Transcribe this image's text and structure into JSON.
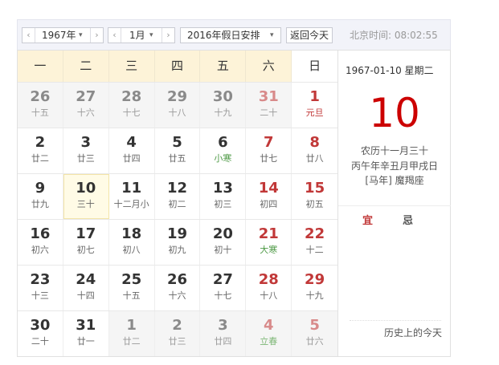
{
  "toolbar": {
    "year": "1967年",
    "month": "1月",
    "holiday": "2016年假日安排",
    "today_label": "返回今天",
    "time_label": "北京时间: 08:02:55",
    "prev_glyph": "‹",
    "next_glyph": "›",
    "caret_glyph": "▾"
  },
  "weekdays": [
    "一",
    "二",
    "三",
    "四",
    "五",
    "六",
    "日"
  ],
  "calendar": {
    "weeks": [
      [
        {
          "num": "26",
          "lunar": "十五",
          "other": true
        },
        {
          "num": "27",
          "lunar": "十六",
          "other": true
        },
        {
          "num": "28",
          "lunar": "十七",
          "other": true
        },
        {
          "num": "29",
          "lunar": "十八",
          "other": true
        },
        {
          "num": "30",
          "lunar": "十九",
          "other": true
        },
        {
          "num": "31",
          "lunar": "二十",
          "other": true,
          "weekend": true
        },
        {
          "num": "1",
          "lunar": "元旦",
          "weekend": true,
          "festival": true
        }
      ],
      [
        {
          "num": "2",
          "lunar": "廿二"
        },
        {
          "num": "3",
          "lunar": "廿三"
        },
        {
          "num": "4",
          "lunar": "廿四"
        },
        {
          "num": "5",
          "lunar": "廿五"
        },
        {
          "num": "6",
          "lunar": "小寒",
          "term": true
        },
        {
          "num": "7",
          "lunar": "廿七",
          "weekend": true
        },
        {
          "num": "8",
          "lunar": "廿八",
          "weekend": true
        }
      ],
      [
        {
          "num": "9",
          "lunar": "廿九"
        },
        {
          "num": "10",
          "lunar": "三十",
          "selected": true
        },
        {
          "num": "11",
          "lunar": "十二月小"
        },
        {
          "num": "12",
          "lunar": "初二"
        },
        {
          "num": "13",
          "lunar": "初三"
        },
        {
          "num": "14",
          "lunar": "初四",
          "weekend": true
        },
        {
          "num": "15",
          "lunar": "初五",
          "weekend": true
        }
      ],
      [
        {
          "num": "16",
          "lunar": "初六"
        },
        {
          "num": "17",
          "lunar": "初七"
        },
        {
          "num": "18",
          "lunar": "初八"
        },
        {
          "num": "19",
          "lunar": "初九"
        },
        {
          "num": "20",
          "lunar": "初十"
        },
        {
          "num": "21",
          "lunar": "大寒",
          "weekend": true,
          "term": true
        },
        {
          "num": "22",
          "lunar": "十二",
          "weekend": true
        }
      ],
      [
        {
          "num": "23",
          "lunar": "十三"
        },
        {
          "num": "24",
          "lunar": "十四"
        },
        {
          "num": "25",
          "lunar": "十五"
        },
        {
          "num": "26",
          "lunar": "十六"
        },
        {
          "num": "27",
          "lunar": "十七"
        },
        {
          "num": "28",
          "lunar": "十八",
          "weekend": true
        },
        {
          "num": "29",
          "lunar": "十九",
          "weekend": true
        }
      ],
      [
        {
          "num": "30",
          "lunar": "二十"
        },
        {
          "num": "31",
          "lunar": "廿一"
        },
        {
          "num": "1",
          "lunar": "廿二",
          "other": true
        },
        {
          "num": "2",
          "lunar": "廿三",
          "other": true
        },
        {
          "num": "3",
          "lunar": "廿四",
          "other": true
        },
        {
          "num": "4",
          "lunar": "立春",
          "other": true,
          "weekend": true,
          "term": true
        },
        {
          "num": "5",
          "lunar": "廿六",
          "other": true,
          "weekend": true
        }
      ]
    ]
  },
  "side": {
    "date_line": "1967-01-10  星期二",
    "big_day": "10",
    "lunar_line": "农历十一月三十",
    "ganzhi_line": "丙午年辛丑月甲戌日",
    "zodiac_line": "[马年] 魔羯座",
    "yi": "宜",
    "ji": "忌",
    "history": "历史上的今天"
  },
  "colors": {
    "accent_red": "#c13838",
    "big_day_red": "#cc0000",
    "term_green": "#4e9a46",
    "header_bg": "#fdf3d8",
    "selected_bg": "#fffbe6"
  }
}
